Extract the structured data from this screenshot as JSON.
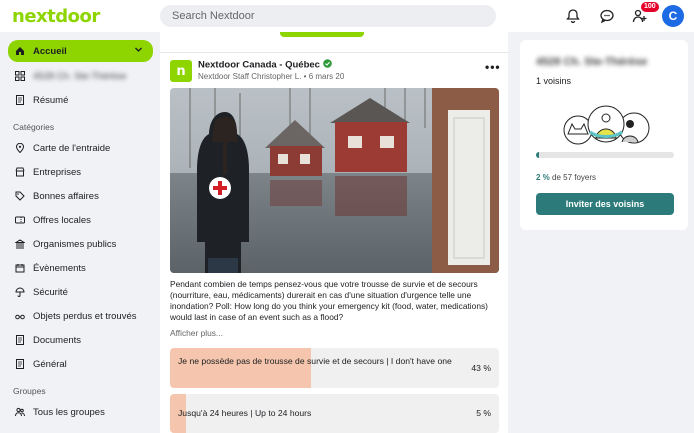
{
  "app": {
    "logo": "nextdoor",
    "search_placeholder": "Search Nextdoor",
    "notification_count": "100",
    "avatar_initial": "C"
  },
  "sidebar": {
    "items": [
      {
        "label": "Accueil",
        "icon": "home-icon"
      },
      {
        "label": "4528 Ch. Ste-Thérèse",
        "icon": "grid-icon"
      },
      {
        "label": "Résumé",
        "icon": "document-icon"
      }
    ],
    "categories_heading": "Catégories",
    "categories": [
      {
        "label": "Carte de l'entraide",
        "icon": "map-pin-icon"
      },
      {
        "label": "Entreprises",
        "icon": "store-icon"
      },
      {
        "label": "Bonnes affaires",
        "icon": "tag-icon"
      },
      {
        "label": "Offres locales",
        "icon": "coupon-icon"
      },
      {
        "label": "Organismes publics",
        "icon": "bank-icon"
      },
      {
        "label": "Évènements",
        "icon": "calendar-icon"
      },
      {
        "label": "Sécurité",
        "icon": "umbrella-icon"
      },
      {
        "label": "Objets perdus et trouvés",
        "icon": "glasses-icon"
      },
      {
        "label": "Documents",
        "icon": "document-icon"
      },
      {
        "label": "Général",
        "icon": "document-icon"
      }
    ],
    "groups_heading": "Groupes",
    "groups": [
      {
        "label": "Tous les groupes",
        "icon": "people-icon"
      }
    ]
  },
  "post": {
    "author": "Nextdoor Canada - Québec",
    "meta": "Nextdoor Staff Christopher L. • 6 mars 20",
    "text": "Pendant combien de temps pensez-vous que votre trousse de survie et de secours (nourriture, eau, médicaments) durerait en cas d'une situation d'urgence telle une inondation? Poll: How long do you think your emergency kit (food, water, medications) would last in case of an event such as a flood?",
    "more_label": "Afficher plus...",
    "poll": [
      {
        "label": "Je ne possède pas de trousse de survie et de secours | I don't have one",
        "percent": "43 %",
        "value": 43
      },
      {
        "label": "Jusqu'à 24 heures | Up to 24 hours",
        "percent": "5 %",
        "value": 5
      }
    ]
  },
  "neighbors_card": {
    "address": "4528 Ch. Ste-Thérèse",
    "neighbors": "1 voisins",
    "progress_value": 2,
    "count_pct": "2 %",
    "count_rest": " de 57 foyers",
    "invite_label": "Inviter des voisins"
  },
  "colors": {
    "brand": "#8ed500",
    "teal": "#2c7b7a",
    "poll_fill": "#f5c6ad"
  }
}
